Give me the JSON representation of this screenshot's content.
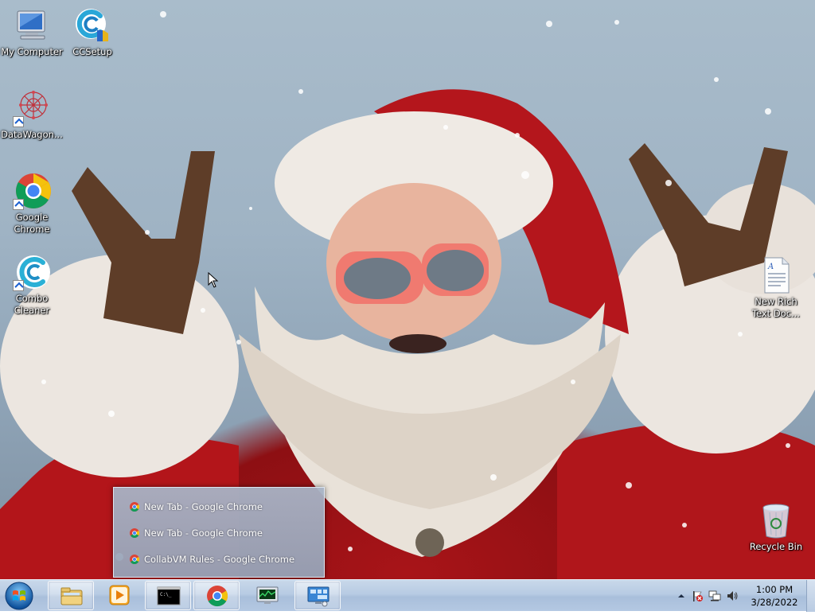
{
  "desktop": {
    "icons": [
      {
        "label": "My Computer",
        "icon": "computer-icon"
      },
      {
        "label": "CCSetup",
        "icon": "ccleaner-setup-icon"
      },
      {
        "label": "DataWagon...",
        "icon": "datawagon-icon"
      },
      {
        "label": "Google Chrome",
        "icon": "chrome-icon"
      },
      {
        "label": "Combo Cleaner",
        "icon": "combo-cleaner-icon"
      },
      {
        "label": "New Rich Text Doc...",
        "icon": "rich-text-document-icon"
      },
      {
        "label": "Recycle Bin",
        "icon": "recycle-bin-icon"
      }
    ]
  },
  "popup": {
    "items": [
      {
        "label": "New Tab - Google Chrome"
      },
      {
        "label": "New Tab - Google Chrome"
      },
      {
        "label": "CollabVM Rules - Google Chrome"
      }
    ]
  },
  "taskbar": {
    "buttons": [
      {
        "icon": "file-explorer-icon"
      },
      {
        "icon": "media-player-icon"
      },
      {
        "icon": "command-prompt-icon"
      },
      {
        "icon": "chrome-icon"
      },
      {
        "icon": "task-manager-icon"
      },
      {
        "icon": "remote-desktop-icon"
      }
    ],
    "clock": {
      "time": "1:00 PM",
      "date": "3/28/2022"
    }
  },
  "colors": {
    "chrome_red": "#db4437",
    "chrome_yellow": "#f4c20d",
    "chrome_green": "#0f9d58",
    "chrome_blue": "#4285f4",
    "taskbar": "#b7cbe3"
  }
}
